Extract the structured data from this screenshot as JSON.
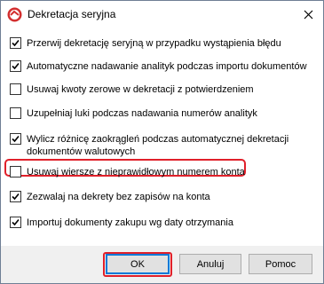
{
  "window": {
    "title": "Dekretacja seryjna"
  },
  "options": [
    {
      "label": "Przerwij dekretację seryjną w przypadku wystąpienia błędu",
      "checked": true
    },
    {
      "label": "Automatyczne nadawanie analityk podczas importu dokumentów",
      "checked": true
    },
    {
      "label": "Usuwaj kwoty zerowe w dekretacji z potwierdzeniem",
      "checked": false
    },
    {
      "label": "Uzupełniaj luki podczas nadawania numerów analityk",
      "checked": false
    },
    {
      "label_line1": "Wylicz różnicę zaokrągleń podczas automatycznej dekretacji",
      "label_line2": "dokumentów walutowych",
      "checked": true
    },
    {
      "label": "Usuwaj wiersze z nieprawidłowym numerem konta",
      "checked": false
    },
    {
      "label": "Zezwalaj na dekrety bez zapisów na konta",
      "checked": true
    },
    {
      "label": "Importuj dokumenty zakupu wg daty otrzymania",
      "checked": true
    }
  ],
  "buttons": {
    "ok": "OK",
    "cancel": "Anuluj",
    "help": "Pomoc"
  },
  "icons": {
    "app": "app-logo-icon",
    "close": "close-icon",
    "check": "checkmark-icon"
  }
}
